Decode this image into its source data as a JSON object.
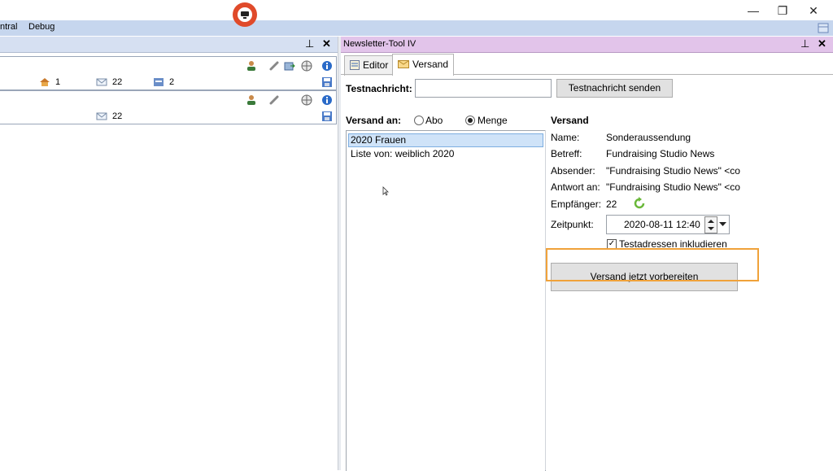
{
  "window": {
    "minimize_glyph": "—",
    "restore_glyph": "❐",
    "close_glyph": "✕"
  },
  "menu": {
    "items": [
      "ntral",
      "Debug"
    ]
  },
  "left_panel": {
    "pin_glyph": "⊥",
    "close_glyph": "✕",
    "record1": {
      "home_count": "1",
      "mail_count": "22",
      "group_count": "2"
    },
    "record2": {
      "mail_count": "22"
    }
  },
  "right_panel": {
    "title": "Newsletter-Tool IV",
    "pin_glyph": "⊥",
    "close_glyph": "✕",
    "tabs": [
      {
        "label": "Editor"
      },
      {
        "label": "Versand"
      }
    ],
    "test": {
      "label": "Testnachricht:",
      "value": "",
      "button": "Testnachricht senden"
    },
    "versand_an": {
      "label": "Versand an:",
      "options": [
        {
          "label": "Abo",
          "selected": false
        },
        {
          "label": "Menge",
          "selected": true
        }
      ]
    },
    "list": {
      "items": [
        "2020 Frauen",
        "Liste von: weiblich 2020"
      ]
    },
    "details": {
      "heading": "Versand",
      "name_label": "Name:",
      "name_value": "Sonderaussendung",
      "subject_label": "Betreff:",
      "subject_value": "Fundraising Studio News",
      "sender_label": "Absender:",
      "sender_value": "\"Fundraising Studio News\" <co",
      "reply_label": "Antwort an:",
      "reply_value": "\"Fundraising Studio News\" <co",
      "recipients_label": "Empfänger:",
      "recipients_value": "22",
      "time_label": "Zeitpunkt:",
      "time_value": "2020-08-11 12:40",
      "test_addresses_label": "Testadressen inkludieren",
      "test_addresses_checked": true,
      "prepare_button": "Versand jetzt vorbereiten"
    }
  },
  "colors": {
    "menubar": "#c6d6ee",
    "right_header": "#e2c4ea",
    "highlight": "#f0a23a",
    "recording": "#e04a2a"
  }
}
